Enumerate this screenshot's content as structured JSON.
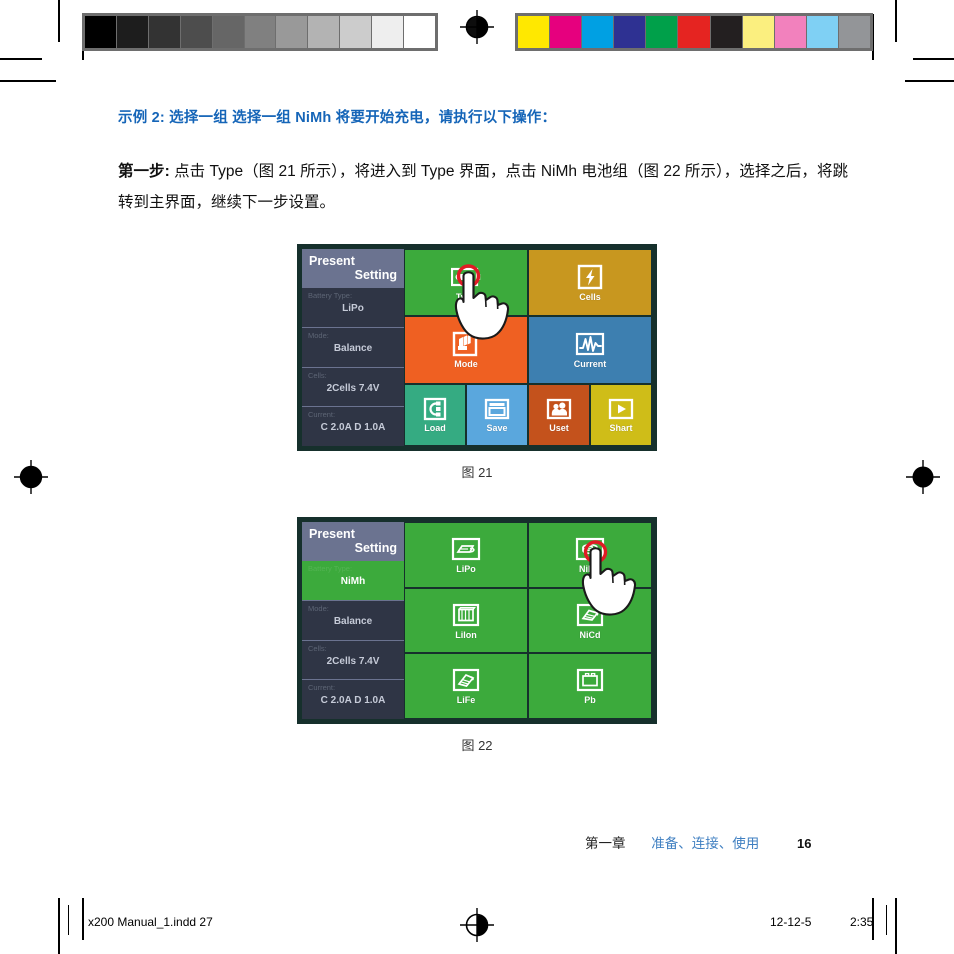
{
  "document": {
    "heading": "示例 2: 选择一组 选择一组 NiMh 将要开始充电，请执行以下操作：",
    "step_label": "第一步:",
    "step_text": " 点击 Type（图 21 所示），将进入到 Type 界面，点击 NiMh 电池组（图 22 所示），选择之后，将跳转到主界面，继续下一步设置。",
    "fig21_caption": "图 21",
    "fig22_caption": "图 22"
  },
  "colors": {
    "accent_blue": "#1565b8",
    "device_bezel": "#16302c",
    "sidebar_bg": "#31384a",
    "sidebar_title_bg": "#6b7390",
    "green": "#3caa3c",
    "orange": "#ef6022",
    "gold": "#c8971f",
    "steel_blue": "#3d7fb0",
    "teal": "#35ab82",
    "sky": "#5aa7dd",
    "rust": "#c4521c",
    "yellow": "#cfbd18",
    "highlight_ring": "#e01b24"
  },
  "figure21": {
    "panel_title_line1": "Present",
    "panel_title_line2": "Setting",
    "settings": [
      {
        "label": "Battery Type:",
        "value": "LiPo",
        "highlighted": false
      },
      {
        "label": "Mode:",
        "value": "Balance",
        "highlighted": false
      },
      {
        "label": "Cells:",
        "value": "2Cells  7.4V",
        "highlighted": false
      },
      {
        "label": "Current:",
        "value": "C 2.0A  D 1.0A",
        "highlighted": false
      }
    ],
    "tiles": [
      {
        "label": "Type",
        "icon": "battery-icon",
        "color": "#3caa3c"
      },
      {
        "label": "Cells",
        "icon": "bolt-icon",
        "color": "#c8971f"
      },
      {
        "label": "Mode",
        "icon": "cards-icon",
        "color": "#ef6022"
      },
      {
        "label": "Current",
        "icon": "waveform-icon",
        "color": "#3d7fb0"
      },
      {
        "label": "Load",
        "icon": "load-icon",
        "color": "#35ab82"
      },
      {
        "label": "Save",
        "icon": "save-icon",
        "color": "#5aa7dd"
      },
      {
        "label": "Uset",
        "icon": "users-icon",
        "color": "#c4521c"
      },
      {
        "label": "Shart",
        "icon": "play-icon",
        "color": "#cfbd18"
      }
    ],
    "pointer_target": "Type"
  },
  "figure22": {
    "panel_title_line1": "Present",
    "panel_title_line2": "Setting",
    "settings": [
      {
        "label": "Battery Type:",
        "value": "NiMh",
        "highlighted": true
      },
      {
        "label": "Mode:",
        "value": "Balance",
        "highlighted": false
      },
      {
        "label": "Cells:",
        "value": "2Cells  7.4V",
        "highlighted": false
      },
      {
        "label": "Current:",
        "value": "C 2.0A  D 1.0A",
        "highlighted": false
      }
    ],
    "tiles": [
      {
        "label": "LiPo",
        "icon": "lipo-pack-icon",
        "color": "#3caa3c"
      },
      {
        "label": "NiMh",
        "icon": "nimh-cell-icon",
        "color": "#3caa3c"
      },
      {
        "label": "LiIon",
        "icon": "liion-cells-icon",
        "color": "#3caa3c"
      },
      {
        "label": "NiCd",
        "icon": "nicd-pack-icon",
        "color": "#3caa3c"
      },
      {
        "label": "LiFe",
        "icon": "life-pack-icon",
        "color": "#3caa3c"
      },
      {
        "label": "Pb",
        "icon": "lead-battery-icon",
        "color": "#3caa3c"
      }
    ],
    "pointer_target": "NiMh"
  },
  "page_footer": {
    "chapter": "第一章",
    "section": "准备、连接、使用",
    "page_number": "16"
  },
  "print_imprint": {
    "filename": "x200 Manual_1.indd   27",
    "date": "12-12-5",
    "time": "2:35"
  },
  "calibration": {
    "grayscale": [
      "#000000",
      "#1d1d1d",
      "#333333",
      "#4d4d4d",
      "#666666",
      "#808080",
      "#999999",
      "#b3b3b3",
      "#cccccc",
      "#eeeeee",
      "#ffffff"
    ],
    "colorbar": [
      "#ffe800",
      "#e6007e",
      "#00a0e3",
      "#2e3192",
      "#00a04a",
      "#e52421",
      "#231f20",
      "#fbef7f",
      "#f281bd",
      "#7fd0f4",
      "#939598"
    ]
  }
}
